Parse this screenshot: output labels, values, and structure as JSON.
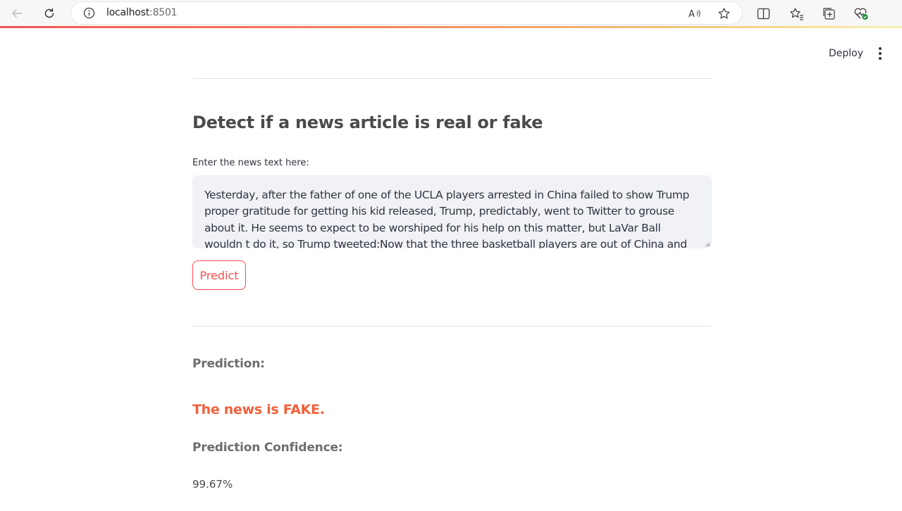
{
  "browser": {
    "url_host": "localhost",
    "url_port": ":8501",
    "icons": [
      "back-icon",
      "refresh-icon",
      "info-icon",
      "read-aloud-icon",
      "favorite-star-icon",
      "split-screen-icon",
      "favorites-icon",
      "collections-icon",
      "browser-essentials-icon"
    ]
  },
  "header": {
    "deploy_label": "Deploy"
  },
  "main": {
    "title": "Detect if a news article is real or fake",
    "input_label": "Enter the news text here:",
    "input_value": "Yesterday, after the father of one of the UCLA players arrested in China failed to show Trump proper gratitude for getting his kid released, Trump, predictably, went to Twitter to grouse about it. He seems to expect to be worshiped for his help on this matter, but LaVar Ball wouldn t do it, so Trump tweeted:Now that the three basketball players are out of China and saved from years in jail, LaVar",
    "predict_label": "Predict",
    "prediction_heading": "Prediction:",
    "prediction_result": "The news is FAKE.",
    "confidence_heading": "Prediction Confidence:",
    "confidence_value": "99.67%"
  },
  "colors": {
    "accent": "#ff4b4b",
    "fake_result": "#f0603a"
  }
}
